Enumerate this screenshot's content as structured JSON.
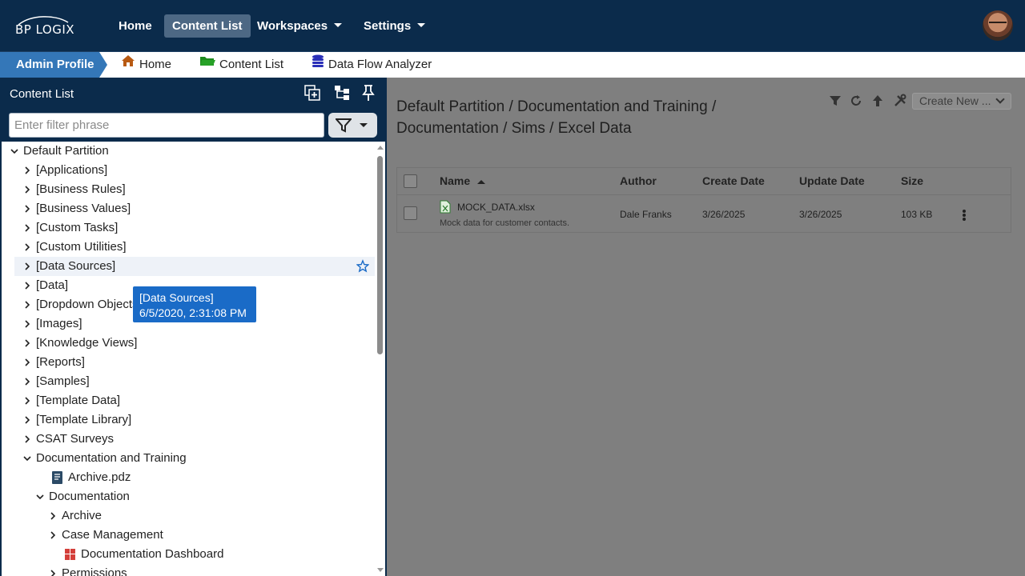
{
  "topnav": {
    "logo_text": "BP LOGIX",
    "items": [
      {
        "label": "Home"
      },
      {
        "label": "Content List"
      },
      {
        "label": "Workspaces"
      },
      {
        "label": "Settings"
      }
    ]
  },
  "subbar": {
    "admin_label": "Admin Profile",
    "crumbs": [
      {
        "label": "Home",
        "icon": "home-icon"
      },
      {
        "label": "Content List",
        "icon": "folder-icon"
      },
      {
        "label": "Data Flow Analyzer",
        "icon": "database-icon"
      }
    ]
  },
  "left_panel": {
    "title": "Content List",
    "filter_placeholder": "Enter filter phrase",
    "tree": [
      {
        "label": "Default Partition",
        "expanded": true
      },
      {
        "label": "[Applications]"
      },
      {
        "label": "[Business Rules]"
      },
      {
        "label": "[Business Values]"
      },
      {
        "label": "[Custom Tasks]"
      },
      {
        "label": "[Custom Utilities]"
      },
      {
        "label": "[Data Sources]"
      },
      {
        "label": "[Data]"
      },
      {
        "label": "[Dropdown Objects]"
      },
      {
        "label": "[Images]"
      },
      {
        "label": "[Knowledge Views]"
      },
      {
        "label": "[Reports]"
      },
      {
        "label": "[Samples]"
      },
      {
        "label": "[Template Data]"
      },
      {
        "label": "[Template Library]"
      },
      {
        "label": "CSAT Surveys"
      },
      {
        "label": "Documentation and Training",
        "expanded": true
      },
      {
        "label": "Archive.pdz"
      },
      {
        "label": "Documentation",
        "expanded": true
      },
      {
        "label": "Archive"
      },
      {
        "label": "Case Management"
      },
      {
        "label": "Documentation Dashboard"
      },
      {
        "label": "Permissions"
      }
    ],
    "tooltip": {
      "line1": "[Data Sources]",
      "line2": "6/5/2020, 2:31:08 PM"
    }
  },
  "main": {
    "path_title": "Default Partition / Documentation and Training / Documentation / Sims / Excel Data",
    "create_new_label": "Create New ...",
    "columns": [
      "Name",
      "Author",
      "Create Date",
      "Update Date",
      "Size"
    ],
    "rows": [
      {
        "name": "MOCK_DATA.xlsx",
        "description": "Mock data for customer contacts.",
        "author": "Dale Franks",
        "create_date": "3/26/2025",
        "update_date": "3/26/2025",
        "size": "103 KB"
      }
    ]
  },
  "colors": {
    "nav_bg": "#0b2b4b",
    "accent": "#3477b8",
    "tooltip": "#1a6bc7",
    "overlay": "#7f7f7f"
  }
}
